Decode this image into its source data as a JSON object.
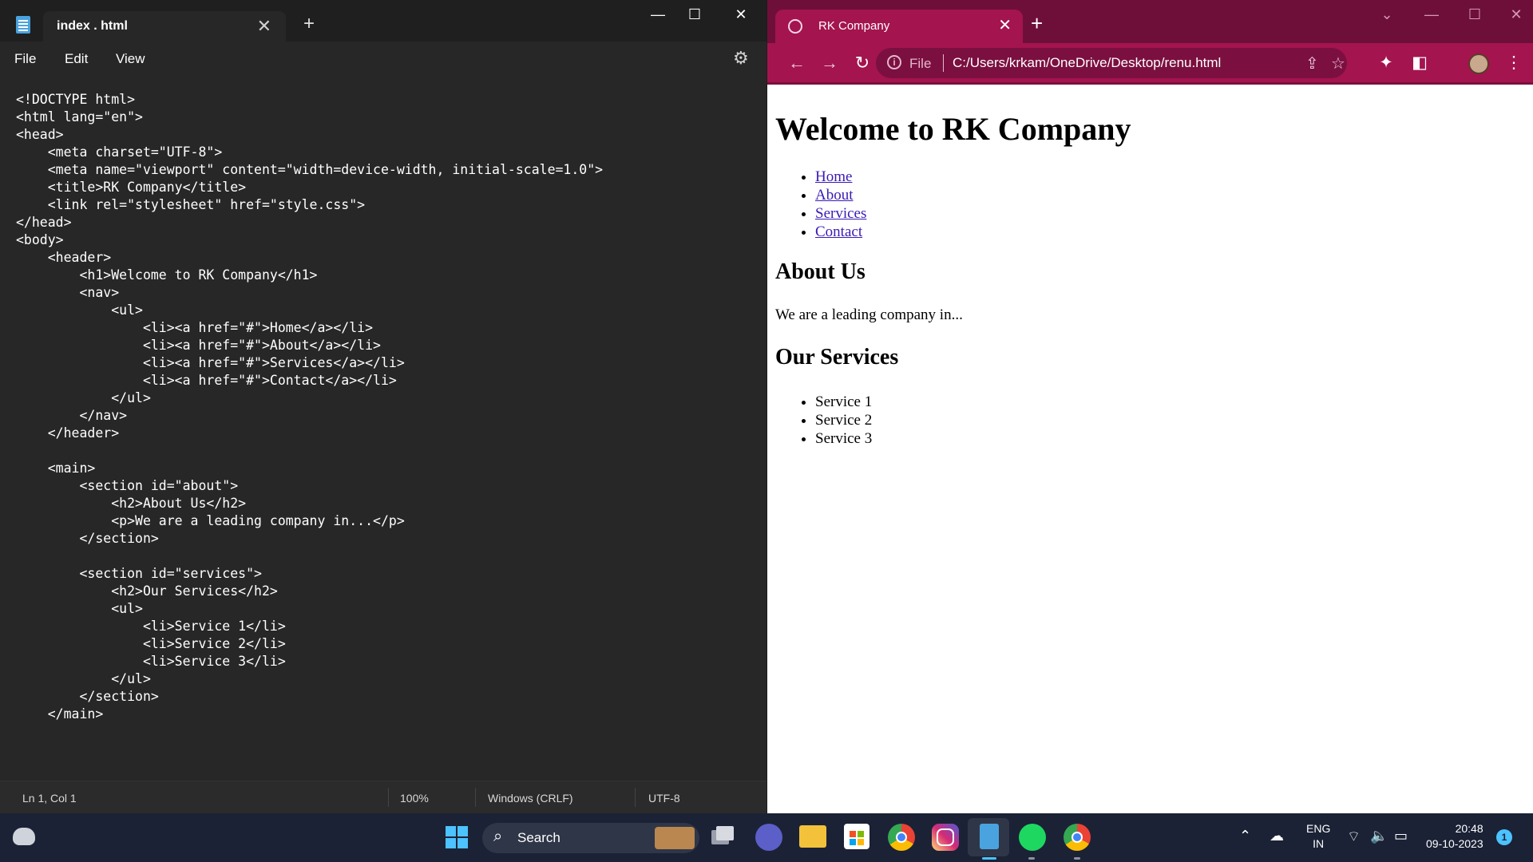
{
  "notepad": {
    "tab_title": "index . html",
    "tab_close": "✕",
    "new_tab": "+",
    "window_buttons": {
      "minimize": "—",
      "maximize": "☐",
      "close": "✕"
    },
    "menu": [
      "File",
      "Edit",
      "View"
    ],
    "code_lines": [
      "<!DOCTYPE html>",
      "<html lang=\"en\">",
      "<head>",
      "    <meta charset=\"UTF-8\">",
      "    <meta name=\"viewport\" content=\"width=device-width, initial-scale=1.0\">",
      "    <title>RK Company</title>",
      "    <link rel=\"stylesheet\" href=\"style.css\">",
      "</head>",
      "<body>",
      "    <header>",
      "        <h1>Welcome to RK Company</h1>",
      "        <nav>",
      "            <ul>",
      "                <li><a href=\"#\">Home</a></li>",
      "                <li><a href=\"#\">About</a></li>",
      "                <li><a href=\"#\">Services</a></li>",
      "                <li><a href=\"#\">Contact</a></li>",
      "            </ul>",
      "        </nav>",
      "    </header>",
      "",
      "    <main>",
      "        <section id=\"about\">",
      "            <h2>About Us</h2>",
      "            <p>We are a leading company in...</p>",
      "        </section>",
      "",
      "        <section id=\"services\">",
      "            <h2>Our Services</h2>",
      "            <ul>",
      "                <li>Service 1</li>",
      "                <li>Service 2</li>",
      "                <li>Service 3</li>",
      "            </ul>",
      "        </section>",
      "    </main>"
    ],
    "status": {
      "position": "Ln 1, Col 1",
      "zoom": "100%",
      "line_ending": "Windows (CRLF)",
      "encoding": "UTF-8"
    }
  },
  "chrome": {
    "tab_title": "RK Company",
    "tab_close": "✕",
    "new_tab": "+",
    "address": {
      "scheme_label": "File",
      "url": "C:/Users/krkam/OneDrive/Desktop/renu.html"
    },
    "page": {
      "h1": "Welcome to RK Company",
      "nav": [
        "Home",
        "About",
        "Services",
        "Contact"
      ],
      "about_heading": "About Us",
      "about_text": "We are a leading company in...",
      "services_heading": "Our Services",
      "services": [
        "Service 1",
        "Service 2",
        "Service 3"
      ]
    }
  },
  "taskbar": {
    "search_label": "Search",
    "language": "ENG",
    "region": "IN",
    "time": "20:48",
    "date": "09-10-2023",
    "notification_count": "1",
    "apps": [
      "task-view",
      "teams-chat",
      "file-explorer",
      "microsoft-store",
      "chrome",
      "instagram",
      "notepad",
      "spotify",
      "chrome-profile"
    ],
    "colors": {
      "accent": "#4cc2ff",
      "chrome_theme": "#a4144f",
      "taskbar": "#1b2236"
    }
  }
}
